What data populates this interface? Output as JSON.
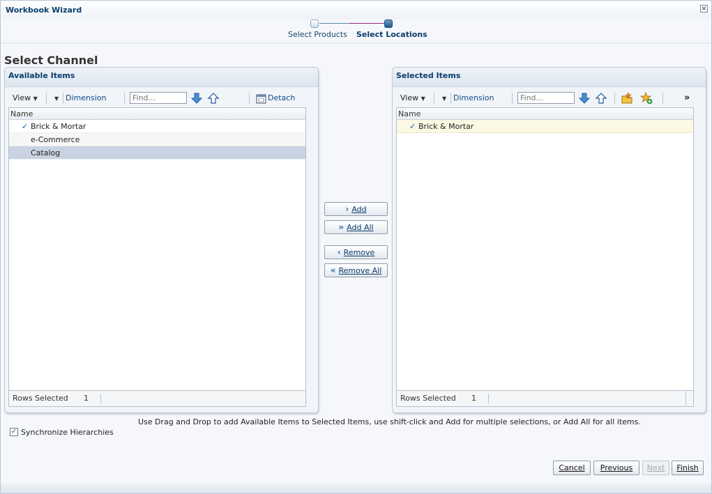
{
  "window": {
    "title": "Workbook Wizard"
  },
  "train": {
    "steps": [
      {
        "label": "Select Products",
        "state": "visited"
      },
      {
        "label": "Select Locations",
        "state": "current"
      }
    ]
  },
  "section_title": "Select Channel",
  "available": {
    "title": "Available Items",
    "toolbar": {
      "view": "View",
      "dimension": "Dimension",
      "find_placeholder": "Find...",
      "detach": "Detach"
    },
    "column_header": "Name",
    "rows": [
      {
        "label": "Brick & Mortar",
        "checked": "✓"
      },
      {
        "label": "e-Commerce",
        "checked": ""
      },
      {
        "label": "Catalog",
        "checked": ""
      }
    ],
    "status": {
      "label": "Rows Selected",
      "value": "1"
    }
  },
  "selected": {
    "title": "Selected Items",
    "toolbar": {
      "view": "View",
      "dimension": "Dimension",
      "find_placeholder": "Find...",
      "more": "»"
    },
    "column_header": "Name",
    "rows": [
      {
        "label": "Brick & Mortar",
        "checked": "✓"
      }
    ],
    "status": {
      "label": "Rows Selected",
      "value": "1"
    }
  },
  "shuttle": {
    "add": "Add",
    "add_all": "Add All",
    "remove": "Remove",
    "remove_all": "Remove All"
  },
  "hint": "Use Drag and Drop to add Available Items to Selected Items, use shift-click and Add for multiple selections, or Add All for all items.",
  "sync": {
    "label": "Synchronize Hierarchies",
    "checked": "✓"
  },
  "footer": {
    "cancel": "Cancel",
    "previous": "Previous",
    "next": "Next",
    "finish": "Finish"
  },
  "colors": {
    "accent": "#0b3d6b",
    "selected_row": "#c9d3e1",
    "highlight_row": "#fbf8e3"
  }
}
